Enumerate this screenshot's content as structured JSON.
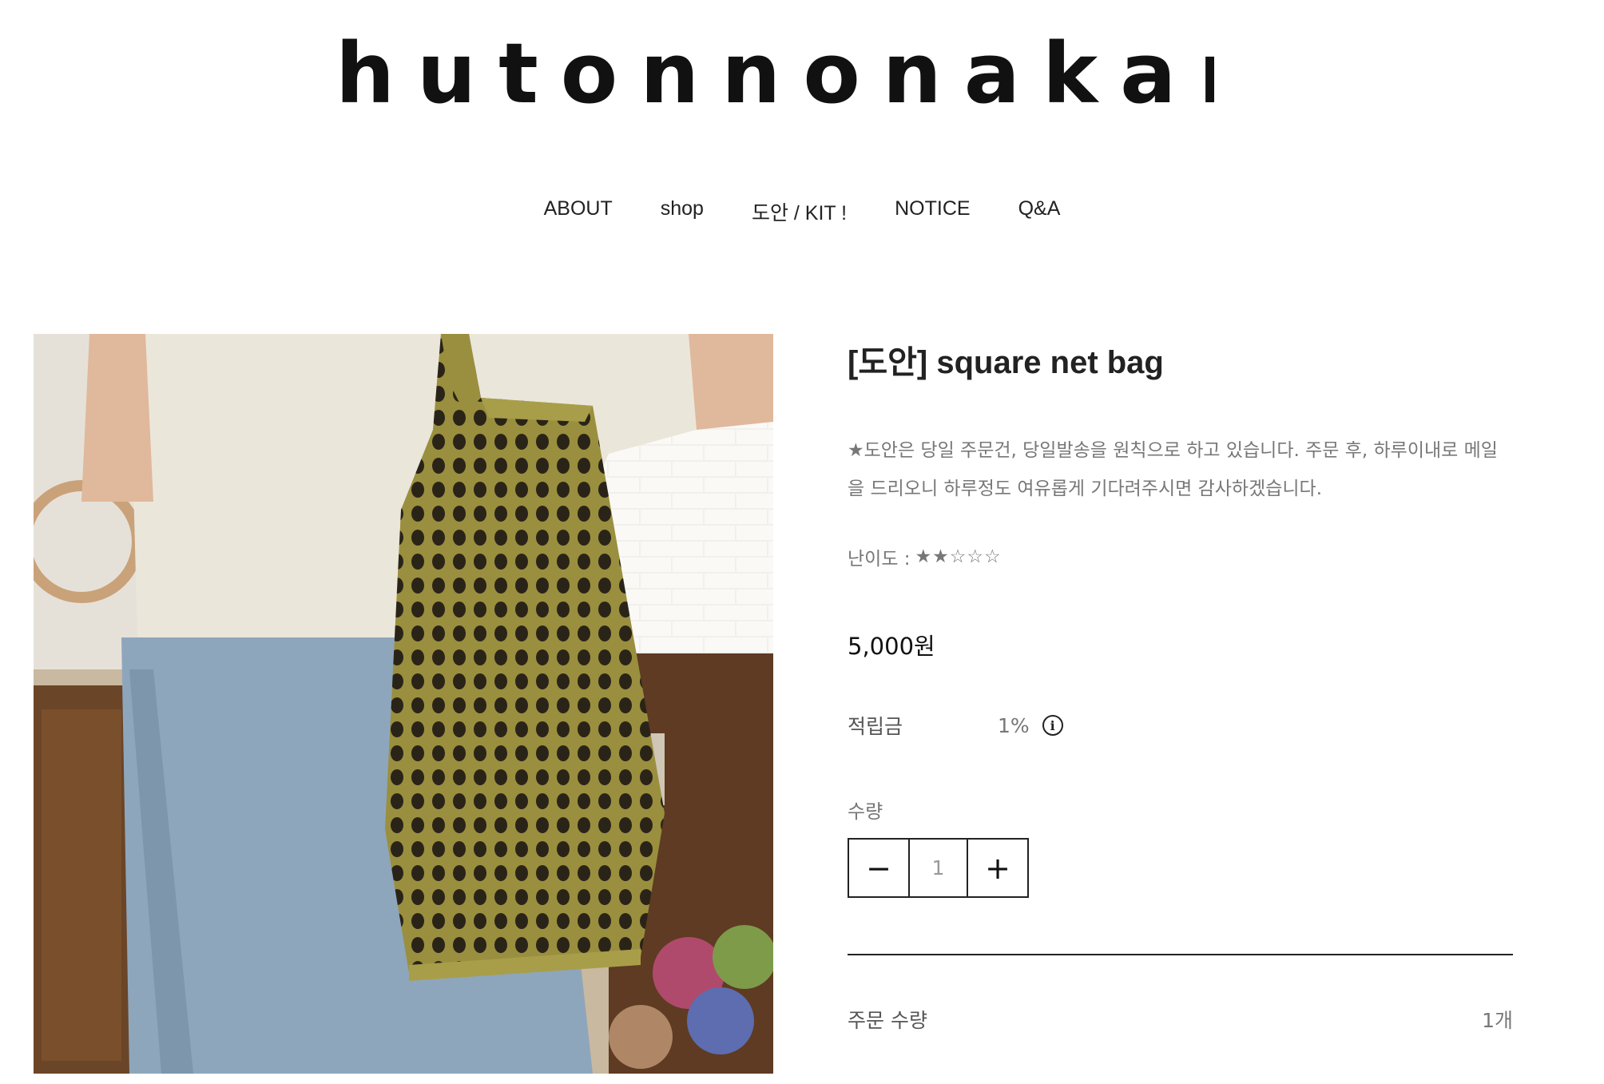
{
  "brand": {
    "logo_text": "hutonnonakanineko"
  },
  "nav": {
    "items": [
      {
        "label": "ABOUT"
      },
      {
        "label": "shop"
      },
      {
        "label": "도안 / KIT !"
      },
      {
        "label": "NOTICE"
      },
      {
        "label": "Q&A"
      }
    ]
  },
  "product": {
    "title": "[도안] square net bag",
    "notice": "★도안은 당일 주문건, 당일발송을 원칙으로 하고 있습니다. 주문 후, 하루이내로 메일을 드리오니 하루정도 여유롭게 기다려주시면 감사하겠습니다.",
    "difficulty_label": "난이도 :",
    "difficulty_stars": "★★☆☆☆",
    "difficulty_rating": 2,
    "difficulty_max": 5,
    "price": "5,000원",
    "points_label": "적립금",
    "points_value": "1%",
    "quantity_label": "수량",
    "quantity_value": "1",
    "minus_label": "−",
    "plus_label": "+",
    "order_qty_label": "주문 수량",
    "order_qty_value": "1개",
    "image_icon": "product-photo-knit-net-bag"
  },
  "colors": {
    "text_dark": "#222222",
    "text_muted": "#777777",
    "bag_olive": "#9a8f3e"
  }
}
